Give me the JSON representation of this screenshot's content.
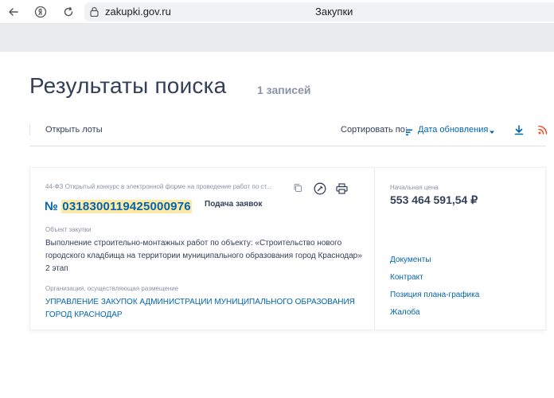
{
  "browser": {
    "url": "zakupki.gov.ru",
    "tab_title": "Закупки"
  },
  "page": {
    "title": "Результаты поиска",
    "records": "1 записей"
  },
  "toolbar": {
    "open_lots": "Открыть лоты",
    "sort_label": "Сортировать по:",
    "sort_value": "Дата обновления"
  },
  "card": {
    "procedure": "44-ФЗ Открытый конкурс в электронной форме на проведение работ по ст...",
    "number_prefix": "№ ",
    "number": "0318300119425000976",
    "stage": "Подача заявок",
    "object_label": "Объект закупки",
    "object_text": "Выполнение строительно-монтажных работ по объекту: «Строительство нового городского кладбища на территории муниципального образования город Краснодар» 2 этап",
    "org_label": "Организация, осуществляющая размещение",
    "org_text": "УПРАВЛЕНИЕ ЗАКУПОК АДМИНИСТРАЦИИ МУНИЦИПАЛЬНОГО ОБРАЗОВАНИЯ ГОРОД КРАСНОДАР",
    "price_label": "Начальная цена",
    "price": "553 464 591,54 ₽",
    "links": [
      "Документы",
      "Контракт",
      "Позиция плана-графика",
      "Жалоба"
    ]
  },
  "colors": {
    "accent": "#0065b1",
    "text": "#334059",
    "muted": "#8a94a6",
    "highlight": "#ffe9a6",
    "rss": "#e8542c"
  },
  "icons": [
    "back-icon",
    "yandex-icon",
    "reload-icon",
    "lock-icon",
    "sort-icon",
    "chevron-down-icon",
    "download-icon",
    "rss-icon",
    "copy-icon",
    "document-icon",
    "print-icon"
  ]
}
